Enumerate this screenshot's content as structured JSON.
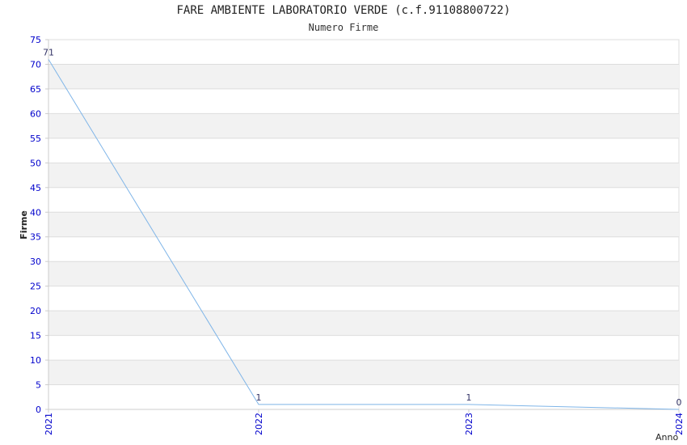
{
  "chart_data": {
    "type": "line",
    "title": "FARE AMBIENTE LABORATORIO VERDE (c.f.91108800722)",
    "subtitle": "Numero Firme",
    "xlabel": "Anno",
    "ylabel": "Firme",
    "x": [
      "2021",
      "2022",
      "2023",
      "2024"
    ],
    "series": [
      {
        "values": [
          71,
          1,
          1,
          0
        ]
      }
    ],
    "data_labels": [
      "71",
      "1",
      "1",
      "0"
    ],
    "ylim": [
      0,
      75
    ],
    "yticks": [
      "0",
      "5",
      "10",
      "15",
      "20",
      "25",
      "30",
      "35",
      "40",
      "45",
      "50",
      "55",
      "60",
      "65",
      "70",
      "75"
    ],
    "grid": "horizontal alternating bands",
    "colors": {
      "line": "#7fb5e8",
      "band": "#f2f2f2",
      "gridline": "#dddddd",
      "tick_label": "#0000cc",
      "data_label": "#333366"
    }
  }
}
